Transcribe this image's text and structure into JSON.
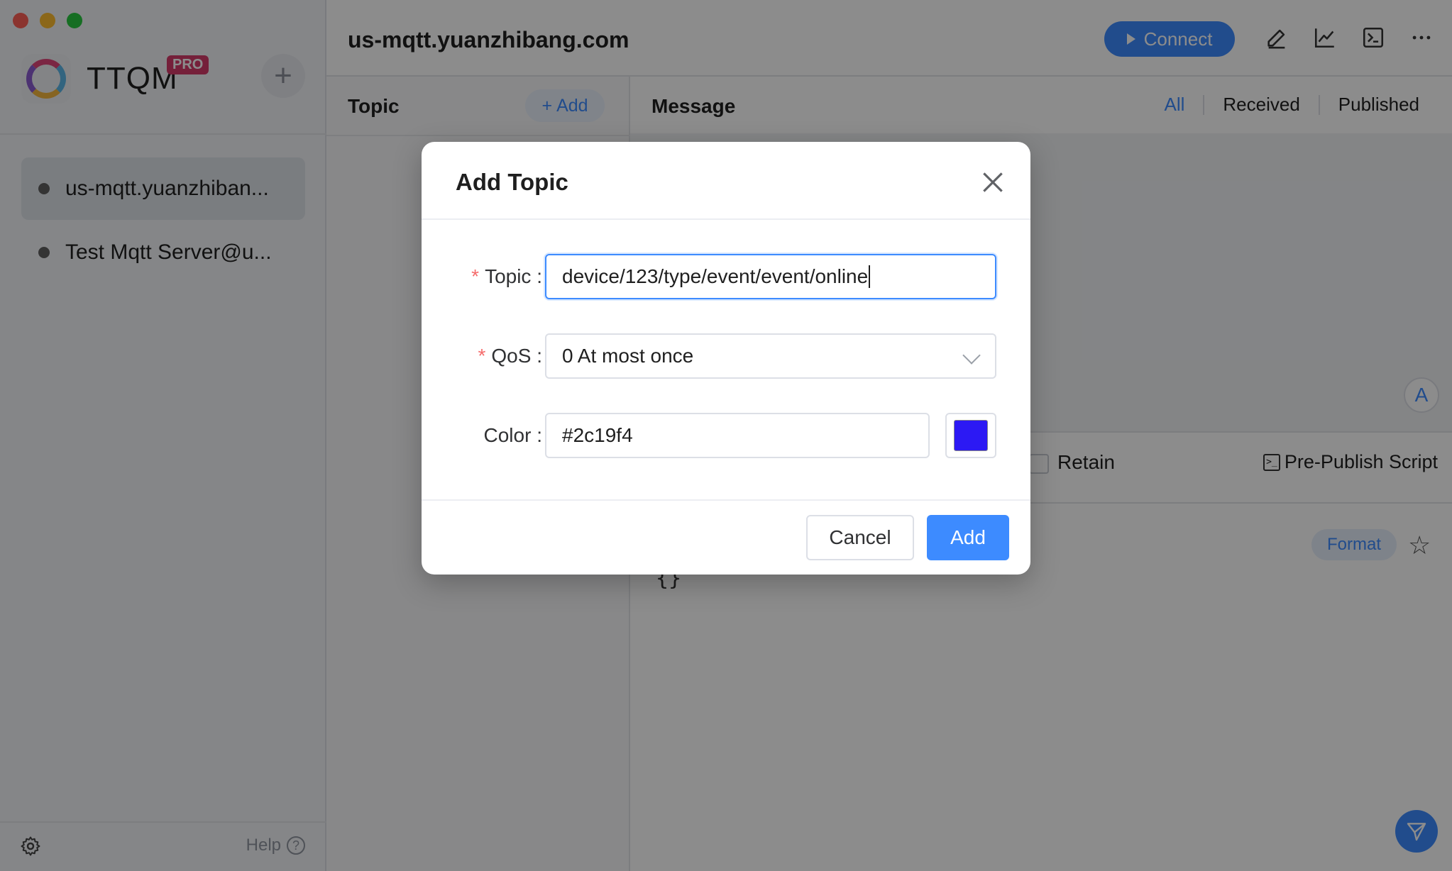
{
  "sidebar": {
    "brand": "TTQM",
    "badge": "PRO",
    "new_connection": "+",
    "connections": [
      {
        "label": "us-mqtt.yuanzhiban...",
        "active": true
      },
      {
        "label": "Test Mqtt Server@u...",
        "active": false
      }
    ],
    "help_label": "Help",
    "help_symbol": "?"
  },
  "header": {
    "title": "us-mqtt.yuanzhibang.com",
    "connect_label": "Connect",
    "icons": [
      "edit-icon",
      "chart-icon",
      "terminal-icon",
      "more-icon"
    ]
  },
  "topics": {
    "heading": "Topic",
    "add_label": "Add",
    "add_symbol": "+"
  },
  "messages": {
    "heading": "Message",
    "tabs": [
      "All",
      "Received",
      "Published"
    ],
    "avatar_letter": "A",
    "retain_label": "Retain",
    "script_label": "Pre-Publish Script",
    "format_label": "Format",
    "payload_preview": "{}"
  },
  "dialog": {
    "title": "Add Topic",
    "topic_label": "Topic",
    "topic_value": "device/123/type/event/event/online",
    "qos_label": "QoS",
    "qos_value": "0 At most once",
    "color_label": "Color",
    "color_value": "#2c19f4",
    "colon": ":",
    "required_mark": "*",
    "cancel_label": "Cancel",
    "add_label": "Add"
  },
  "colors": {
    "accent": "#3d8bff",
    "swatch": "#2c19f4",
    "required": "#f56c6c"
  }
}
